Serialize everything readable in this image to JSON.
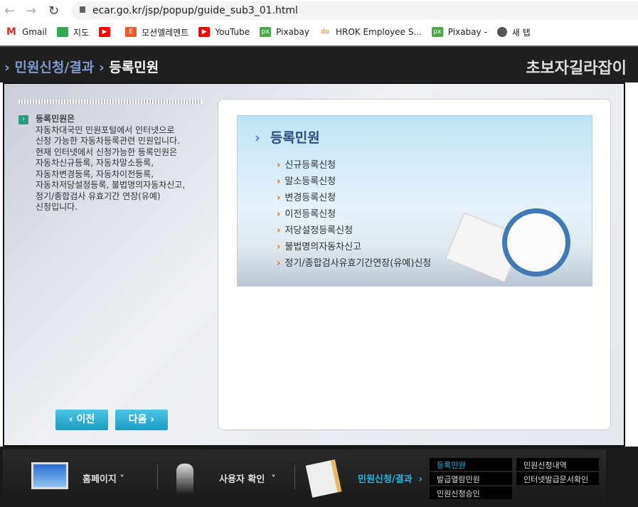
{
  "browser": {
    "url": "ecar.go.kr/jsp/popup/guide_sub3_01.html",
    "bookmarks": [
      {
        "label": "Gmail",
        "icon": "gmail-icon"
      },
      {
        "label": "지도",
        "icon": "maps-icon"
      },
      {
        "label": "",
        "icon": "youtube-icon"
      },
      {
        "label": "모션엘레멘트",
        "icon": "motionelements-icon"
      },
      {
        "label": "YouTube",
        "icon": "youtube-icon"
      },
      {
        "label": "Pixabay",
        "icon": "pixabay-icon"
      },
      {
        "label": "HROK Employee S...",
        "icon": "hrok-icon"
      },
      {
        "label": "Pixabay -",
        "icon": "pixabay-icon"
      },
      {
        "label": "새 탭",
        "icon": "globe-icon"
      }
    ]
  },
  "header": {
    "breadcrumb_parent": "민원신청/결과",
    "breadcrumb_current": "등록민원",
    "guide_title": "초보자길라잡이"
  },
  "left": {
    "title": "등록민원은",
    "body": "자동차대국민 민원포털에서 인터넷으로\n신청 가능한 자동차등록관련 민원입니다.\n현재 인터넷에서 신청가능한 등록민원은\n자동차신규등록, 자동차말소등록,\n자동차변경등록, 자동차이전등록,\n자동차저당설정등록, 불법명의자동차신고,\n정기/종합검사 유효기간 연장(유예)\n신청입니다.",
    "prev": "‹ 이전",
    "next": "다음 ›"
  },
  "panel": {
    "title": "등록민원",
    "items": [
      "신규등록신청",
      "말소등록신청",
      "변경등록신청",
      "이전등록신청",
      "저당설정등록신청",
      "불법명의자동차신고",
      "정기/종합검사유효기간연장(유예)신청"
    ]
  },
  "footer": {
    "home": "홈페이지",
    "user": "사용자 확인",
    "result": "민원신청/결과",
    "sub": [
      "등록민원",
      "민원신청내역",
      "발급열람민원",
      "인터넷발급문서확인",
      "민원신청승인"
    ],
    "active_color": "#2ab4e0"
  }
}
